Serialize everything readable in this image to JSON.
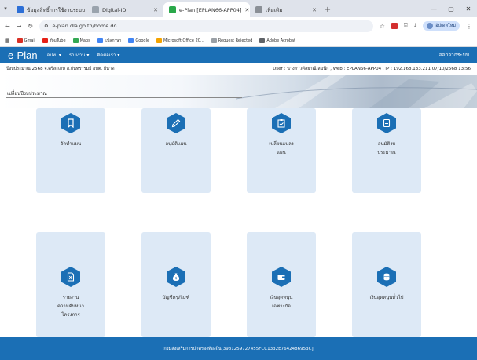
{
  "browser": {
    "tabs": [
      {
        "label": "ข้อมูลสิทธิ์การใช้งานระบบ",
        "favicon_color": "#2d6fd6",
        "active": false
      },
      {
        "label": "Digital-ID",
        "favicon_color": "#9aa3ad",
        "active": false
      },
      {
        "label": "e-Plan [EPLAN66-APP04]",
        "favicon_color": "#2aa84a",
        "active": true
      },
      {
        "label": "เพิ่มเติม",
        "favicon_color": "#8a8f96",
        "active": false
      }
    ],
    "url": "e-plan.dla.go.th/home.do",
    "profile_label": "อัปเดตใหม่",
    "bookmarks": [
      {
        "label": "Gmail",
        "color": "#d93025"
      },
      {
        "label": "YouTube",
        "color": "#e62117"
      },
      {
        "label": "Maps",
        "color": "#34a853"
      },
      {
        "label": "แปลภาษา",
        "color": "#4285f4"
      },
      {
        "label": "Google",
        "color": "#4285f4"
      },
      {
        "label": "Microsoft Office 20...",
        "color": "#f4a300"
      },
      {
        "label": "Request Rejected",
        "color": "#9aa0a6"
      },
      {
        "label": "Adobe Acrobat",
        "color": "#5f6368"
      }
    ]
  },
  "app": {
    "brand": "e-Plan",
    "menu": [
      "อปท.",
      "รายงาน",
      "ติดต่อเรา"
    ],
    "logout": "ออกจากระบบ",
    "fiscal_info": "ปีงบประมาณ 2568  จ.ศรีสะเกษ อ.กันทรารมย์ อบต. ยืนาด",
    "user_info": "User : นางสาวคัลยาณี สมนึก , Web : EPLAN66-APP04 , IP : 192.168.133.211 07/10/2568 13:56",
    "banner_title": "เปลี่ยนปีงบประมาณ",
    "cards": [
      {
        "label": "จัดทำแผน",
        "icon": "bookmark-icon"
      },
      {
        "label": "อนุมัติแผน",
        "icon": "pen-icon"
      },
      {
        "label": "เปลี่ยนแปลง\nแผน",
        "icon": "clipboard-check-icon"
      },
      {
        "label": "อนุมัติงบ\nประมาณ",
        "icon": "document-list-icon"
      },
      {
        "label": "รายงาน\nความคืบหน้า\nโครงการ",
        "icon": "excel-file-icon"
      },
      {
        "label": "บัญชีครุภัณฑ์",
        "icon": "money-bag-icon"
      },
      {
        "label": "เงินอุดหนุน\nเฉพาะกิจ",
        "icon": "wallet-icon"
      },
      {
        "label": "เงินอุดหนุนทั่วไป",
        "icon": "coins-icon"
      }
    ],
    "footer": "กรมส่งเสริมการปกครองท้องถิ่น[3981259727455FCC1332E7642486953C]"
  },
  "colors": {
    "primary": "#1b6fb5",
    "card_bg": "#dde9f6"
  }
}
